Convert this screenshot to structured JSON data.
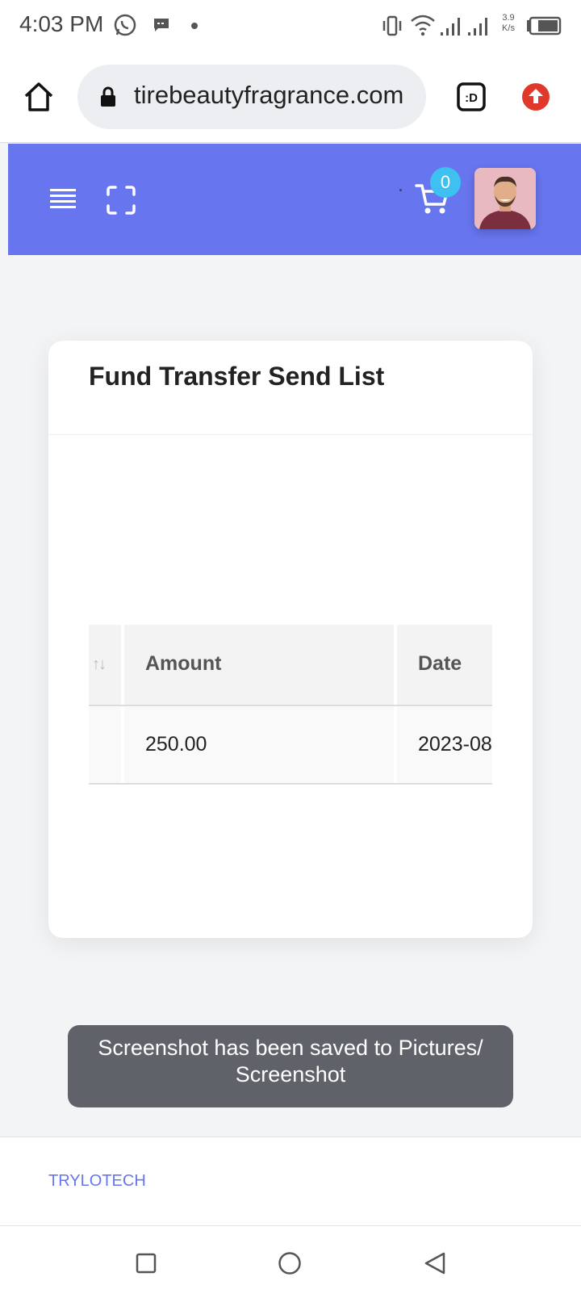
{
  "status_bar": {
    "time": "4:03 PM",
    "net_speed_value": "3.9",
    "net_speed_unit": "K/s",
    "icons": [
      "whatsapp-icon",
      "message-icon",
      "notification-dot",
      "vibrate-icon",
      "wifi-icon",
      "signal-icon",
      "signal-icon",
      "battery-icon"
    ]
  },
  "browser": {
    "url": "tirebeautyfragrance.com",
    "tab_switcher_label": ":D",
    "icons": [
      "home-icon",
      "lock-icon",
      "tab-switcher-icon",
      "update-icon"
    ]
  },
  "app_header": {
    "cart_count": "0",
    "icons": [
      "menu-icon",
      "fullscreen-icon",
      "cart-icon",
      "avatar"
    ]
  },
  "card": {
    "title": "Fund Transfer Send List",
    "table": {
      "columns": [
        "",
        "Amount",
        "Date"
      ],
      "sort_glyph": "↑↓",
      "rows": [
        [
          "",
          "250.00",
          "2023-08"
        ]
      ]
    }
  },
  "toast": {
    "text": "Screenshot has been saved to  Pictures/\nScreenshot"
  },
  "footer": {
    "text": "TRYLOTECH"
  },
  "nav_bar": {
    "icons": [
      "recents-icon",
      "home-circle-icon",
      "back-icon"
    ]
  },
  "colors": {
    "header": "#6775ef",
    "badge": "#3ec0f0",
    "footer_text": "#6775ef",
    "toast_bg": "#5f6268",
    "update_button": "#e0392c"
  }
}
